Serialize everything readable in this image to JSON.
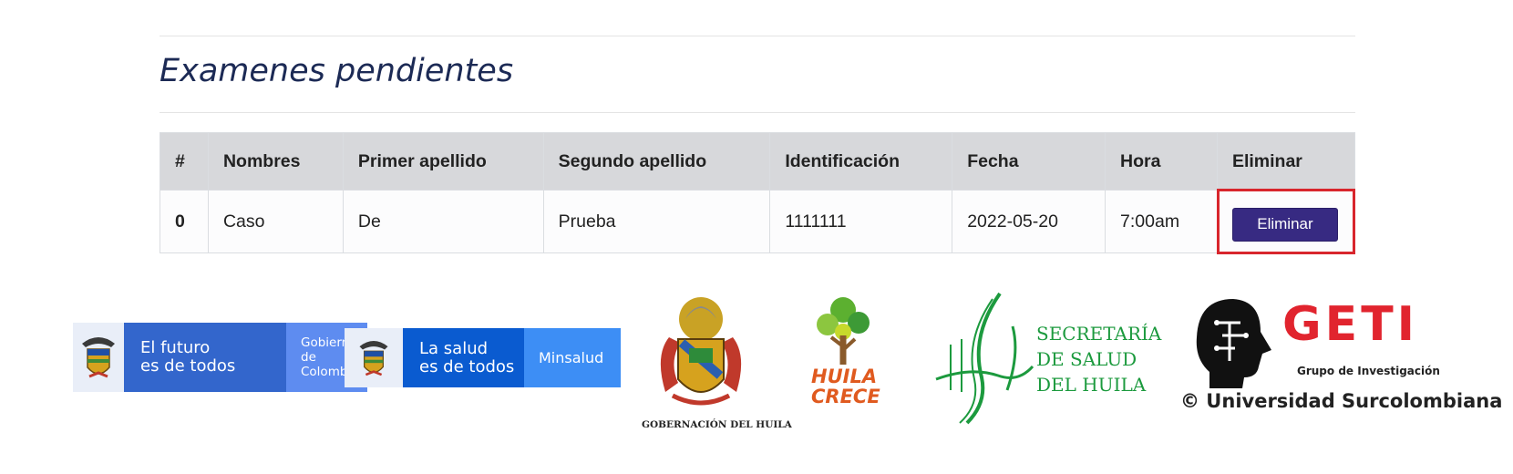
{
  "page": {
    "title": "Examenes pendientes"
  },
  "table": {
    "headers": [
      "#",
      "Nombres",
      "Primer apellido",
      "Segundo apellido",
      "Identificación",
      "Fecha",
      "Hora",
      "Eliminar"
    ],
    "rows": [
      {
        "num": "0",
        "nombres": "Caso",
        "primer_apellido": "De",
        "segundo_apellido": "Prueba",
        "identificacion": "1111111",
        "fecha": "2022-05-20",
        "hora": "7:00am",
        "eliminar_label": "Eliminar"
      }
    ]
  },
  "colors": {
    "title": "#1c2a55",
    "header_bg": "#d7d8db",
    "button": "#372a82",
    "highlight": "#d8262d"
  },
  "footer": {
    "gobierno": {
      "line1": "El futuro",
      "line2": "es de todos",
      "right1": "Gobierno",
      "right2": "de Colombia"
    },
    "minsalud": {
      "line1": "La salud",
      "line2": "es de todos",
      "right": "Minsalud"
    },
    "gobernacion": {
      "caption": "GOBERNACIÓN DEL HUILA"
    },
    "huila_crece": {
      "line1": "HUILA",
      "line2": "CRECE"
    },
    "secretaria": {
      "line1": "SECRETARÍA",
      "line2": "DE SALUD",
      "line3": "DEL HUILA"
    },
    "geti": {
      "name": "GETI",
      "subtitle": "Grupo de Investigación",
      "university": "© Universidad Surcolombiana"
    }
  }
}
